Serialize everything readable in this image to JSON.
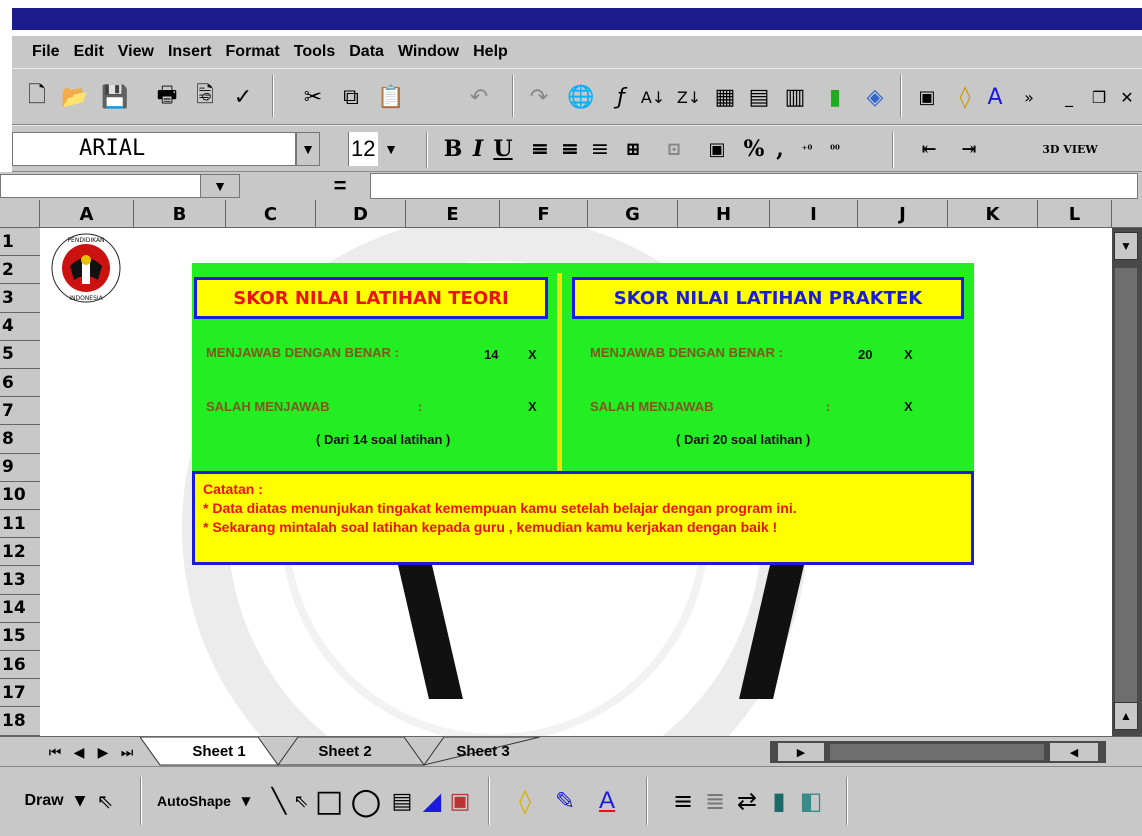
{
  "menu": [
    "File",
    "Edit",
    "View",
    "Insert",
    "Format",
    "Tools",
    "Data",
    "Window",
    "Help"
  ],
  "format_toolbar": {
    "font_name": "ARIAL",
    "font_size": "12",
    "bold": "B",
    "italic": "I",
    "underline": "U",
    "percent": "%",
    "comma": ",",
    "view_3d": "3D VIEW"
  },
  "formula_bar": {
    "equals": "="
  },
  "columns": [
    "A",
    "B",
    "C",
    "D",
    "E",
    "F",
    "G",
    "H",
    "I",
    "J",
    "K",
    "L"
  ],
  "rows": [
    "1",
    "2",
    "3",
    "4",
    "5",
    "6",
    "7",
    "8",
    "9",
    "10",
    "11",
    "12",
    "13",
    "14",
    "15",
    "16",
    "17",
    "18"
  ],
  "board": {
    "left": {
      "title": "SKOR NILAI LATIHAN TEORI",
      "correct_label": "MENJAWAB DENGAN BENAR :",
      "correct_value": "14",
      "correct_mark": "X",
      "wrong_label": "SALAH MENJAWAB",
      "wrong_colon": ":",
      "wrong_mark": "X",
      "subtitle": "( Dari 14 soal latihan )"
    },
    "right": {
      "title": "SKOR NILAI LATIHAN PRAKTEK",
      "correct_label": "MENJAWAB DENGAN BENAR :",
      "correct_value": "20",
      "correct_mark": "X",
      "wrong_label": "SALAH MENJAWAB",
      "wrong_colon": ":",
      "wrong_mark": "X",
      "subtitle": "( Dari 20 soal latihan )"
    },
    "note": {
      "heading": "Catatan :",
      "line1": "* Data diatas menunjukan tingakat kemempuan kamu setelah  belajar dengan program ini.",
      "line2": "* Sekarang mintalah soal latihan kepada guru , kemudian kamu kerjakan dengan baik !"
    }
  },
  "sheets": [
    "Sheet 1",
    "Sheet 2",
    "Sheet 3"
  ],
  "draw_toolbar": {
    "draw": "Draw",
    "autoshape": "AutoShape"
  },
  "colors": {
    "title_bar": "#1b1b8e",
    "board_green": "#22ee22",
    "board_yellow": "#ffff00",
    "border_blue": "#1a1ae0",
    "accent_red": "#ee1111"
  }
}
